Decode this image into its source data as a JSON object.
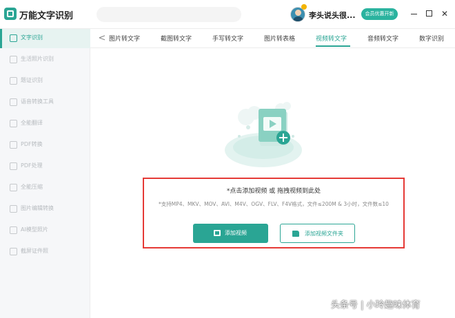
{
  "app": {
    "title": "万能文字识别"
  },
  "user": {
    "name": "李头说头很..."
  },
  "header": {
    "vip_button": "会员优惠开新"
  },
  "sidebar": {
    "items": [
      {
        "label": "文字识别",
        "active": true
      },
      {
        "label": "生活照片识别"
      },
      {
        "label": "题证识别"
      },
      {
        "label": "语音转换工具"
      },
      {
        "label": "全能翻译"
      },
      {
        "label": "PDF转换"
      },
      {
        "label": "PDF处理"
      },
      {
        "label": "全能压缩"
      },
      {
        "label": "图片编辑转换"
      },
      {
        "label": "AI模型照片"
      },
      {
        "label": "截屏证件照"
      }
    ]
  },
  "tabs": [
    {
      "label": "图片转文字"
    },
    {
      "label": "截图转文字"
    },
    {
      "label": "手写转文字"
    },
    {
      "label": "图片转表格"
    },
    {
      "label": "视频转文字",
      "active": true
    },
    {
      "label": "音频转文字"
    },
    {
      "label": "数字识别"
    }
  ],
  "upload": {
    "title": "*点击添加视频 或 拖拽视频到此处",
    "hint": "*支持MP4、MKV、MOV、AVI、M4V、OGV、FLV、F4V格式，文件≤200M & 3小时，文件数≤10",
    "add_video_label": "添加视频",
    "add_folder_label": "添加视频文件夹"
  },
  "watermark": "头条号 | 小玲趣味体育",
  "colors": {
    "accent": "#2aa594",
    "highlight_border": "#e53935"
  },
  "icons": {
    "app_logo": "app-logo-icon",
    "back": "chevron-left-icon",
    "upload": "video-upload-icon",
    "add_video": "video-icon",
    "add_folder": "folder-icon"
  }
}
